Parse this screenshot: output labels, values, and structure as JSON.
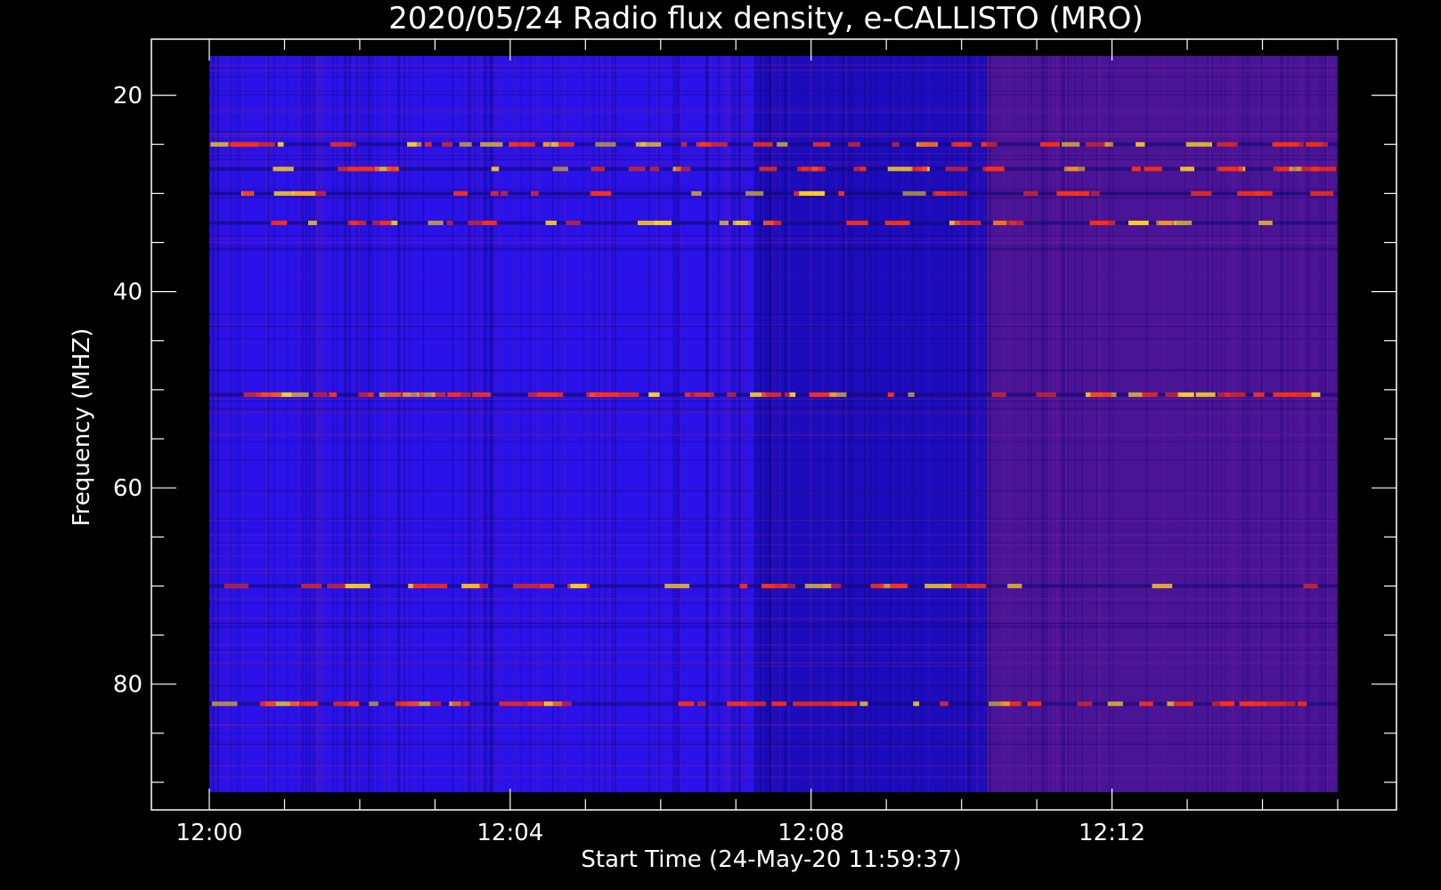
{
  "chart_data": {
    "type": "heatmap",
    "title": "2020/05/24  Radio flux density, e-CALLISTO (MRO)",
    "xlabel": "Start Time (24-May-20 11:59:37)",
    "ylabel": "Frequency (MHZ)",
    "x_ticks": [
      "12:00",
      "12:04",
      "12:08",
      "12:12"
    ],
    "y_ticks": [
      20,
      40,
      60,
      80
    ],
    "y_range_mhz": [
      16,
      91
    ],
    "y_inverted": true,
    "x_range": [
      "12:00",
      "12:15"
    ],
    "segments": [
      {
        "start": "12:00",
        "end": "12:07:15",
        "tone": "blue"
      },
      {
        "start": "12:07:15",
        "end": "12:10:20",
        "tone": "dark-blue"
      },
      {
        "start": "12:10:20",
        "end": "12:15",
        "tone": "purple"
      }
    ],
    "bright_bands_mhz": [
      25,
      27.5,
      30,
      33,
      50.5,
      70,
      82
    ],
    "colors": {
      "background": "#000000",
      "blue": "#2a12e8",
      "dark_blue": "#1c0cbc",
      "purple": "#4a1496",
      "hot": "#ff3010",
      "hotter": "#ffd020"
    }
  }
}
